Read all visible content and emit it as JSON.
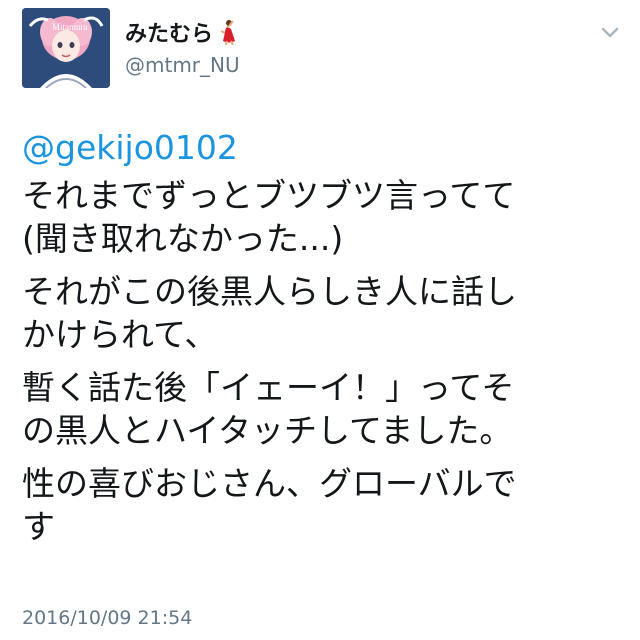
{
  "user": {
    "display_name": "みたむら",
    "name_emoji": "dancer-emoji",
    "handle": "@mtmr_NU",
    "avatar": "profile-illustration"
  },
  "menu_icon": "chevron-down-icon",
  "tweet": {
    "mention": "@gekijo0102",
    "paragraphs": [
      [
        "それまでずっとブツブツ言ってて",
        "(聞き取れなかった...)"
      ],
      [
        "それがこの後黒人らしき人に話し",
        "かけられて、"
      ],
      [
        "暫く話た後「イェーイ！」ってそ",
        "の黒人とハイタッチしてました。"
      ],
      [
        "性の喜びおじさん、グローバルで",
        "す"
      ]
    ],
    "timestamp": "2016/10/09 21:54"
  },
  "colors": {
    "link": "#1b95e0",
    "secondary_text": "#657786",
    "primary_text": "#14171a"
  }
}
